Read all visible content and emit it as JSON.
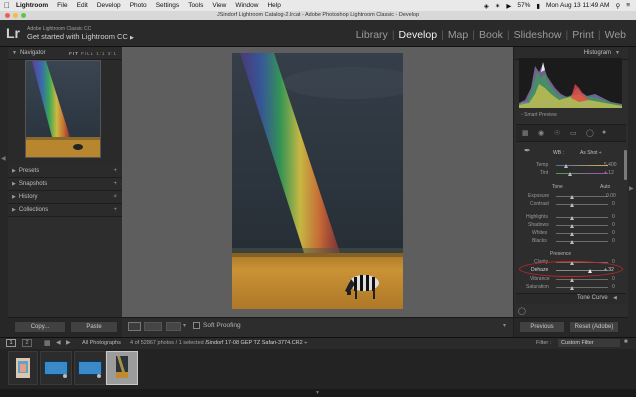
{
  "menubar": {
    "apple": "",
    "app": "Lightroom",
    "items": [
      "File",
      "Edit",
      "Develop",
      "Photo",
      "Settings",
      "Tools",
      "View",
      "Window",
      "Help"
    ],
    "battery": "57%",
    "clock": "Mon Aug 13  11:49 AM"
  },
  "window": {
    "title": "JSindorf Lightroom Catalog-2.lrcat - Adobe Photoshop Lightroom Classic - Develop"
  },
  "identity": {
    "logo": "Lr",
    "line1": "Adobe Lightroom Classic CC",
    "line2": "Get started with Lightroom CC"
  },
  "modules": [
    "Library",
    "Develop",
    "Map",
    "Book",
    "Slideshow",
    "Print",
    "Web"
  ],
  "active_module": "Develop",
  "left_panel": {
    "navigator": "Navigator",
    "nav_zoom": [
      "FIT",
      "FILL",
      "1:1",
      "3:1"
    ],
    "sections": [
      {
        "label": "Presets",
        "ctl": "+"
      },
      {
        "label": "Snapshots",
        "ctl": "+"
      },
      {
        "label": "History",
        "ctl": "×"
      },
      {
        "label": "Collections",
        "ctl": "+"
      }
    ],
    "copy": "Copy...",
    "paste": "Paste"
  },
  "toolbar": {
    "soft_proofing": "Soft Proofing"
  },
  "right_panel": {
    "histogram": "Histogram",
    "iso": "ISO 100",
    "focal": "200 mm",
    "aperture": "f / 5.6",
    "shutter": "1/500 sec",
    "smart_preview": "Smart Preview",
    "wb_label": "WB :",
    "wb_value": "As Shot ÷",
    "temp_label": "Temp",
    "temp_value": "5,400",
    "tint_label": "Tint",
    "tint_value": "+ 12",
    "tone": "Tone",
    "auto": "Auto",
    "tone_rows": [
      {
        "label": "Exposure",
        "value": "0.00"
      },
      {
        "label": "Contrast",
        "value": "0"
      },
      {
        "label": "Highlights",
        "value": "0"
      },
      {
        "label": "Shadows",
        "value": "0"
      },
      {
        "label": "Whites",
        "value": "0"
      },
      {
        "label": "Blacks",
        "value": "0"
      }
    ],
    "presence": "Presence",
    "clarity_label": "Clarity",
    "clarity_value": "0",
    "dehaze_label": "Dehaze",
    "dehaze_value": "+ 32",
    "dehaze_level": 0.66,
    "vibrance_label": "Vibrance",
    "vibrance_value": "0",
    "saturation_label": "Saturation",
    "saturation_value": "0",
    "tone_curve": "Tone Curve",
    "previous": "Previous",
    "reset": "Reset (Adobe)"
  },
  "filmbar": {
    "page1": "1",
    "page2": "2",
    "source": "All Photographs",
    "info": "4 of 52867 photos / 1 selected /",
    "file": "Sindorf 17-08 GEP TZ Safari-3774.CR2 ÷",
    "filter_label": "Filter :",
    "filter_value": "Custom Filter"
  },
  "colors": {
    "accent_red": "#c0262a",
    "panel": "#2d2d2d",
    "photo_bg": "#5e5e5e"
  }
}
